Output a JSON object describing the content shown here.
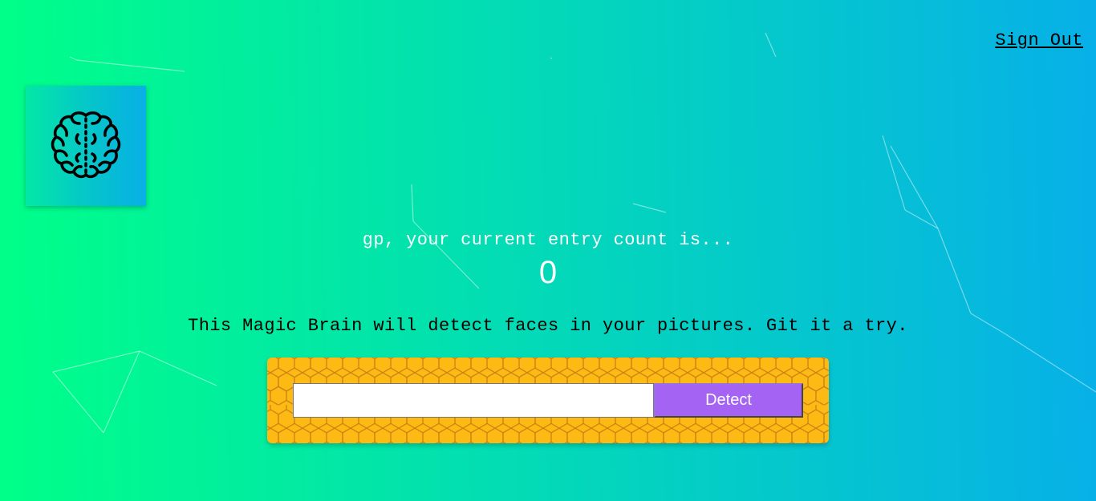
{
  "nav": {
    "signout_label": "Sign Out"
  },
  "logo": {
    "icon": "brain-icon"
  },
  "rank": {
    "message": "gp, your current entry count is...",
    "count": "0"
  },
  "description": "This Magic Brain will detect faces in your pictures. Git it a try.",
  "image_form": {
    "url_value": "",
    "url_placeholder": "",
    "detect_label": "Detect"
  },
  "colors": {
    "gradient_start": "#00ff88",
    "gradient_end": "#07b0e8",
    "form_background": "#fdb914",
    "button_background": "#a463f2",
    "logo_gradient_start": "#03e8a6",
    "logo_gradient_end": "#08afe6"
  }
}
